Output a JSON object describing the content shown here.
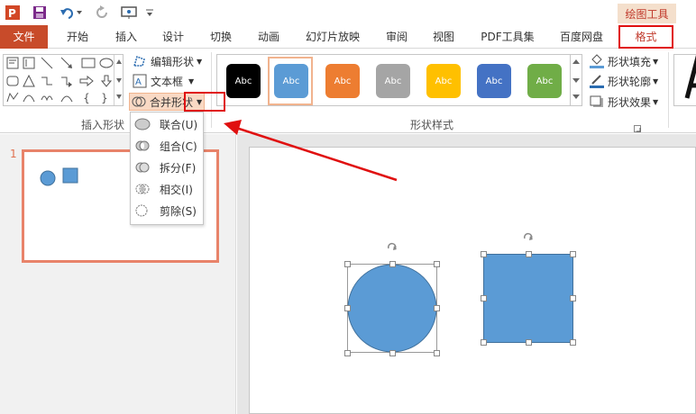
{
  "app": {
    "icon_label": "P",
    "context_tools_label": "绘图工具"
  },
  "tabs": [
    {
      "label": "文件"
    },
    {
      "label": "开始"
    },
    {
      "label": "插入"
    },
    {
      "label": "设计"
    },
    {
      "label": "切换"
    },
    {
      "label": "动画"
    },
    {
      "label": "幻灯片放映"
    },
    {
      "label": "审阅"
    },
    {
      "label": "视图"
    },
    {
      "label": "PDF工具集"
    },
    {
      "label": "百度网盘"
    },
    {
      "label": "格式"
    }
  ],
  "insert_shapes": {
    "group_label": "插入形状",
    "edit_shape_label": "编辑形状",
    "textbox_label": "文本框",
    "merge_shapes_label": "合并形状"
  },
  "shape_styles": {
    "group_label": "形状样式",
    "swatch_text": "Abc",
    "swatches": [
      {
        "color": "#000000"
      },
      {
        "color": "#5b9bd5"
      },
      {
        "color": "#ed7d31"
      },
      {
        "color": "#a5a5a5"
      },
      {
        "color": "#ffc000"
      },
      {
        "color": "#4472c4"
      },
      {
        "color": "#70ad47"
      }
    ],
    "fill_label": "形状填充",
    "outline_label": "形状轮廓",
    "effect_label": "形状效果"
  },
  "merge_menu": {
    "items": [
      {
        "label": "联合(U)"
      },
      {
        "label": "组合(C)"
      },
      {
        "label": "拆分(F)"
      },
      {
        "label": "相交(I)"
      },
      {
        "label": "剪除(S)"
      }
    ]
  },
  "thumbnail": {
    "slide_number": "1"
  },
  "colors": {
    "accent": "#c84b2a",
    "shape_fill": "#5b9bd5",
    "highlight_red": "#e01010"
  }
}
